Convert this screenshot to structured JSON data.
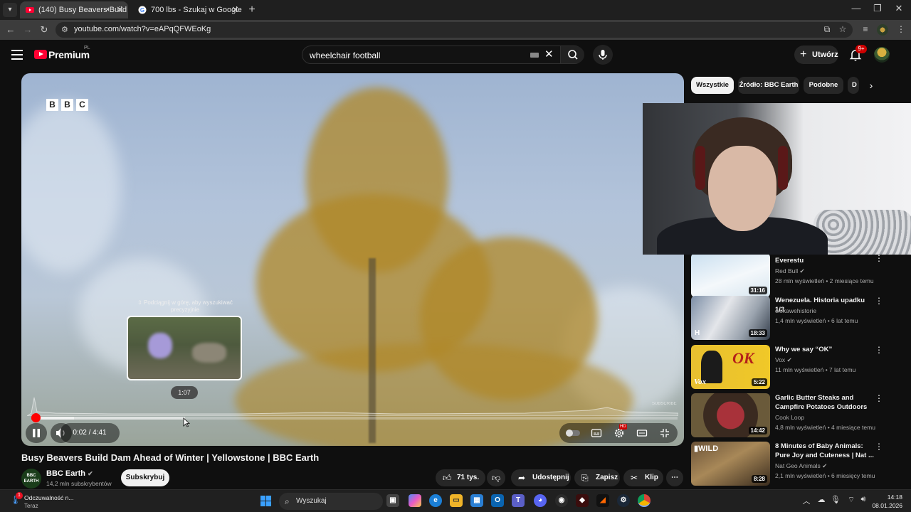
{
  "browser": {
    "tabs": [
      {
        "title": "(140) Busy Beavers Build Da",
        "active": true
      },
      {
        "title": "700 lbs - Szukaj w Google",
        "active": false
      }
    ],
    "url": "youtube.com/watch?v=eAPqQFWEoKg"
  },
  "header": {
    "logo_text": "Premium",
    "logo_country": "PL",
    "search_query": "wheelchair football",
    "create_label": "Utwórz",
    "notifications_badge": "9+"
  },
  "player": {
    "watermark_letters": [
      "B",
      "B",
      "C"
    ],
    "scrub_hint": "⇳ Podciągnij w górę, aby wyszukiwać precyzyjnie",
    "hover_time": "1:07",
    "timecode": "0:02 / 4:41",
    "current_seconds": 2,
    "duration_seconds": 281,
    "subscribe_watermark": "SUBSCRIBE",
    "settings_badge": "HD"
  },
  "video": {
    "title": "Busy Beavers Build Dam Ahead of Winter | Yellowstone | BBC Earth",
    "channel": "BBC Earth",
    "channel_avatar_text": "BBC EARTH",
    "subscribers": "14,2 mln subskrybentów",
    "subscribe_label": "Subskrybuj",
    "likes": "71 tys.",
    "share_label": "Udostępnij",
    "save_label": "Zapisz",
    "clip_label": "Klip"
  },
  "sidebar": {
    "chips": [
      "Wszystkie",
      "Źródło: BBC Earth",
      "Podobne",
      "D"
    ],
    "recommendations": [
      {
        "title": "Everestu",
        "channel": "Red Bull",
        "verified": true,
        "meta": "28 mln wyświetleń • 2 miesiące temu",
        "duration": "31:16"
      },
      {
        "title": "Wenezuela. Historia upadku 1/3",
        "channel": "ciekawehistorie",
        "verified": false,
        "meta": "1,4 mln wyświetleń • 6 lat temu",
        "duration": "18:33"
      },
      {
        "title": "Why we say “OK”",
        "channel": "Vox",
        "verified": true,
        "meta": "11 mln wyświetleń • 7 lat temu",
        "duration": "5:22"
      },
      {
        "title": "Garlic Butter Steaks and Campfire Potatoes Outdoors",
        "channel": "Cook Loop",
        "verified": false,
        "meta": "4,8 mln wyświetleń • 4 miesiące temu",
        "duration": "14:42"
      },
      {
        "title": "8 Minutes of Baby Animals: Pure Joy and Cuteness | Nat ...",
        "channel": "Nat Geo Animals",
        "verified": true,
        "meta": "2,1 mln wyświetleń • 6 miesięcy temu",
        "duration": "8:28"
      }
    ]
  },
  "taskbar": {
    "notification_title": "Odczuwalność n...",
    "notification_time": "Teraz",
    "notification_badge": "1",
    "search_placeholder": "Wyszukaj",
    "time": "14:18",
    "date": "08.01.2026"
  },
  "colors": {
    "youtube_red": "#ff0033",
    "background": "#0f0f0f",
    "chip_selected": "#f1f1f1"
  }
}
